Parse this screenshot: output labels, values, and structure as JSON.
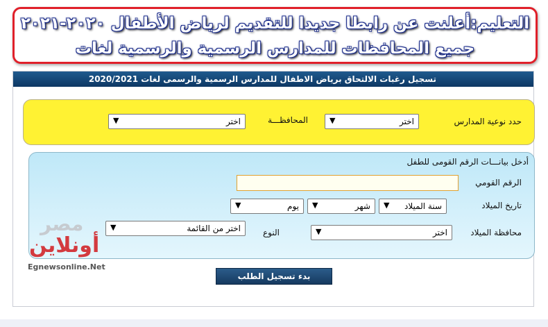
{
  "headline": {
    "line1": "التعليم:أعلنت عن رابطا جديدا للتقديم لرياض الأطفال ٢٠٢٠-٢٠٢١",
    "line2": "جميع المحافظات للمدارس الرسمية والرسمية لغات"
  },
  "form": {
    "title": "تسجيل رغبات الالتحاق برياض الاطفال للمدارس الرسمية والرسمى لغات 2020/2021",
    "school_type": {
      "label": "حدد نوعية المدارس",
      "value": "اختر"
    },
    "governorate": {
      "label": "المحافظـــة",
      "value": "اختر"
    },
    "child_section_title": "أدخل بيانـــات الرقم القومى للطفل",
    "national_id": {
      "label": "الرقم القومي",
      "value": ""
    },
    "birth_date": {
      "label": "تاريخ الميلاد",
      "year": "سنة الميلاد",
      "month": "شهر",
      "day": "يوم"
    },
    "birth_governorate": {
      "label": "محافظة الميلاد",
      "value": "اختر"
    },
    "gender": {
      "label": "النوع",
      "value": "اختر من القائمة"
    },
    "submit_label": "بدء تسجيل الطلب"
  },
  "watermark": {
    "line1": "مصر",
    "line2": "أونلاين",
    "url": "Egnewsonline.Net"
  },
  "icons": {
    "dropdown": "chevron-down-icon"
  },
  "colors": {
    "headline_border": "#e0202a",
    "title_bar": "#0d3763",
    "yellow_panel": "#fff233",
    "blue_panel": "#bfe8f8",
    "accent_red": "#d2262b"
  }
}
